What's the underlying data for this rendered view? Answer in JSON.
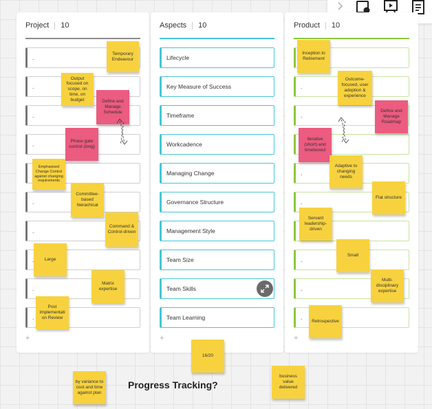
{
  "columns": [
    {
      "title": "Project",
      "count": "10",
      "line_color": "#8c8c8c",
      "border_color": "#777777",
      "cards": [
        ".",
        ".",
        ".",
        ".",
        "",
        ".",
        ".",
        ".",
        ".",
        "."
      ]
    },
    {
      "title": "Aspects",
      "count": "10",
      "line_color": "#45c6d6",
      "border_color": "#45c6d6",
      "cards": [
        "Lifecycle",
        "Key Measure of Success",
        "Timeframe",
        "Workcadence",
        "Managing Change",
        "Governance Structure",
        "Management Style",
        "Team Size",
        "Team Skills",
        "Team Learning"
      ]
    },
    {
      "title": "Product",
      "count": "10",
      "line_color": "#8cc63f",
      "border_color": "#8cc63f",
      "cards": [
        "",
        ".",
        ".",
        "",
        ".",
        ".",
        ".",
        ".",
        ".",
        "."
      ]
    }
  ],
  "add_symbol": "+",
  "stickies": {
    "project": [
      {
        "text": "Temporary Endeavour",
        "color": "yellow"
      },
      {
        "text": "Output focused on scope, on time, on budget",
        "color": "yellow"
      },
      {
        "text": "Define and Manage Schedule",
        "color": "pink"
      },
      {
        "text": "Phase gate control (long)",
        "color": "pink"
      },
      {
        "text": "Emphasised Change Control against changing requirements",
        "color": "yellow"
      },
      {
        "text": "Committee-based hierachical",
        "color": "yellow"
      },
      {
        "text": "Command & Control-driven",
        "color": "yellow"
      },
      {
        "text": "Large",
        "color": "yellow"
      },
      {
        "text": "Matrix expertise",
        "color": "yellow"
      },
      {
        "text": "Post Implementati on Review",
        "color": "yellow"
      }
    ],
    "product": [
      {
        "text": "Inception to Retirement",
        "color": "yellow"
      },
      {
        "text": "Outcome-focused, user adoption & experience",
        "color": "yellow"
      },
      {
        "text": "Define and Manage Roadmap",
        "color": "pink"
      },
      {
        "text": "Iterative (short) and timeboxed",
        "color": "pink"
      },
      {
        "text": "Adaptive to changing needs",
        "color": "yellow"
      },
      {
        "text": "Flat structure",
        "color": "yellow"
      },
      {
        "text": "Servant leadership-driven",
        "color": "yellow"
      },
      {
        "text": "Small",
        "color": "yellow"
      },
      {
        "text": "Multi-disciplinary expertise",
        "color": "yellow"
      },
      {
        "text": "Retrospective",
        "color": "yellow"
      }
    ],
    "free": [
      {
        "text": "16/20",
        "color": "yellow"
      },
      {
        "text": "by variance to cost and time against plan",
        "color": "yellow"
      },
      {
        "text": "business value delivered",
        "color": "yellow"
      }
    ]
  },
  "heading": "Progress Tracking?",
  "toolbar": {
    "icons": [
      "chevron-right-icon",
      "shapes-icon",
      "presentation-icon",
      "notes-icon"
    ]
  }
}
